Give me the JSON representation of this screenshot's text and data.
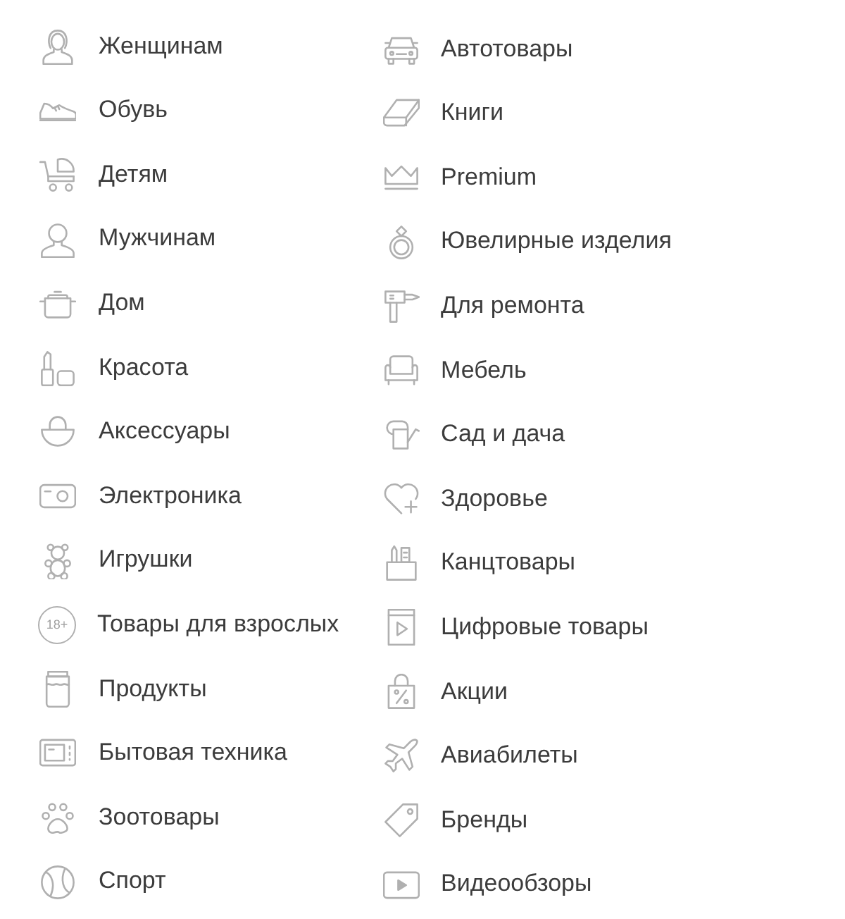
{
  "columns": [
    {
      "items": [
        {
          "label": "Женщинам"
        },
        {
          "label": "Обувь"
        },
        {
          "label": "Детям"
        },
        {
          "label": "Мужчинам"
        },
        {
          "label": "Дом"
        },
        {
          "label": "Красота"
        },
        {
          "label": "Аксессуары"
        },
        {
          "label": "Электроника"
        },
        {
          "label": "Игрушки"
        },
        {
          "label": "Товары для взрослых",
          "sign": "18+"
        },
        {
          "label": "Продукты"
        },
        {
          "label": "Бытовая техника"
        },
        {
          "label": "Зоотовары"
        },
        {
          "label": "Спорт"
        }
      ]
    },
    {
      "items": [
        {
          "label": "Автотовары"
        },
        {
          "label": "Книги"
        },
        {
          "label": "Premium"
        },
        {
          "label": "Ювелирные изделия"
        },
        {
          "label": "Для ремонта"
        },
        {
          "label": "Мебель"
        },
        {
          "label": "Сад и дача"
        },
        {
          "label": "Здоровье"
        },
        {
          "label": "Канцтовары"
        },
        {
          "label": "Цифровые товары"
        },
        {
          "label": "Акции"
        },
        {
          "label": "Авиабилеты"
        },
        {
          "label": "Бренды"
        },
        {
          "label": "Видеообзоры"
        }
      ]
    }
  ]
}
